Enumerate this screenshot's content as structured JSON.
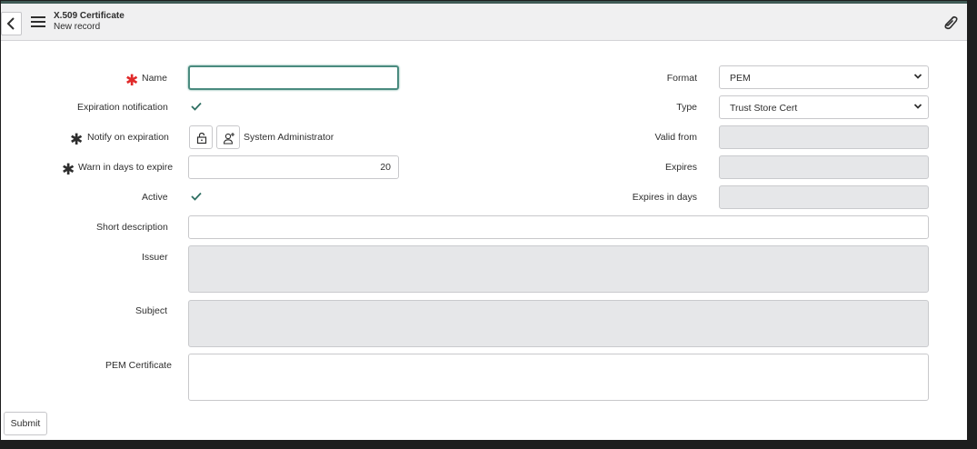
{
  "header": {
    "title": "X.509 Certificate",
    "subtitle": "New record"
  },
  "form": {
    "name": {
      "label": "Name",
      "value": ""
    },
    "expiration_notification": {
      "label": "Expiration notification",
      "checked": true
    },
    "notify_on_expiration": {
      "label": "Notify on expiration",
      "value": "System Administrator"
    },
    "warn_in_days": {
      "label": "Warn in days to expire",
      "value": "20"
    },
    "active": {
      "label": "Active",
      "checked": true
    },
    "short_description": {
      "label": "Short description",
      "value": ""
    },
    "issuer": {
      "label": "Issuer",
      "value": ""
    },
    "subject": {
      "label": "Subject",
      "value": ""
    },
    "pem_certificate": {
      "label": "PEM Certificate",
      "value": ""
    },
    "format": {
      "label": "Format",
      "value": "PEM"
    },
    "type": {
      "label": "Type",
      "value": "Trust Store Cert"
    },
    "valid_from": {
      "label": "Valid from",
      "value": ""
    },
    "expires": {
      "label": "Expires",
      "value": ""
    },
    "expires_in_days": {
      "label": "Expires in days",
      "value": ""
    }
  },
  "actions": {
    "submit_label": "Submit"
  },
  "icons": {
    "back": "chevron-left-icon",
    "menu": "hamburger-menu-icon",
    "attachment": "paperclip-icon",
    "lock": "unlock-icon",
    "add_me": "add-user-icon",
    "required": "asterisk-icon"
  },
  "colors": {
    "required_mandatory": "#e02a2a",
    "focus_border": "#4a8b7f",
    "checkmark": "#2e6f62",
    "readonly_bg": "#e6e7e9"
  }
}
